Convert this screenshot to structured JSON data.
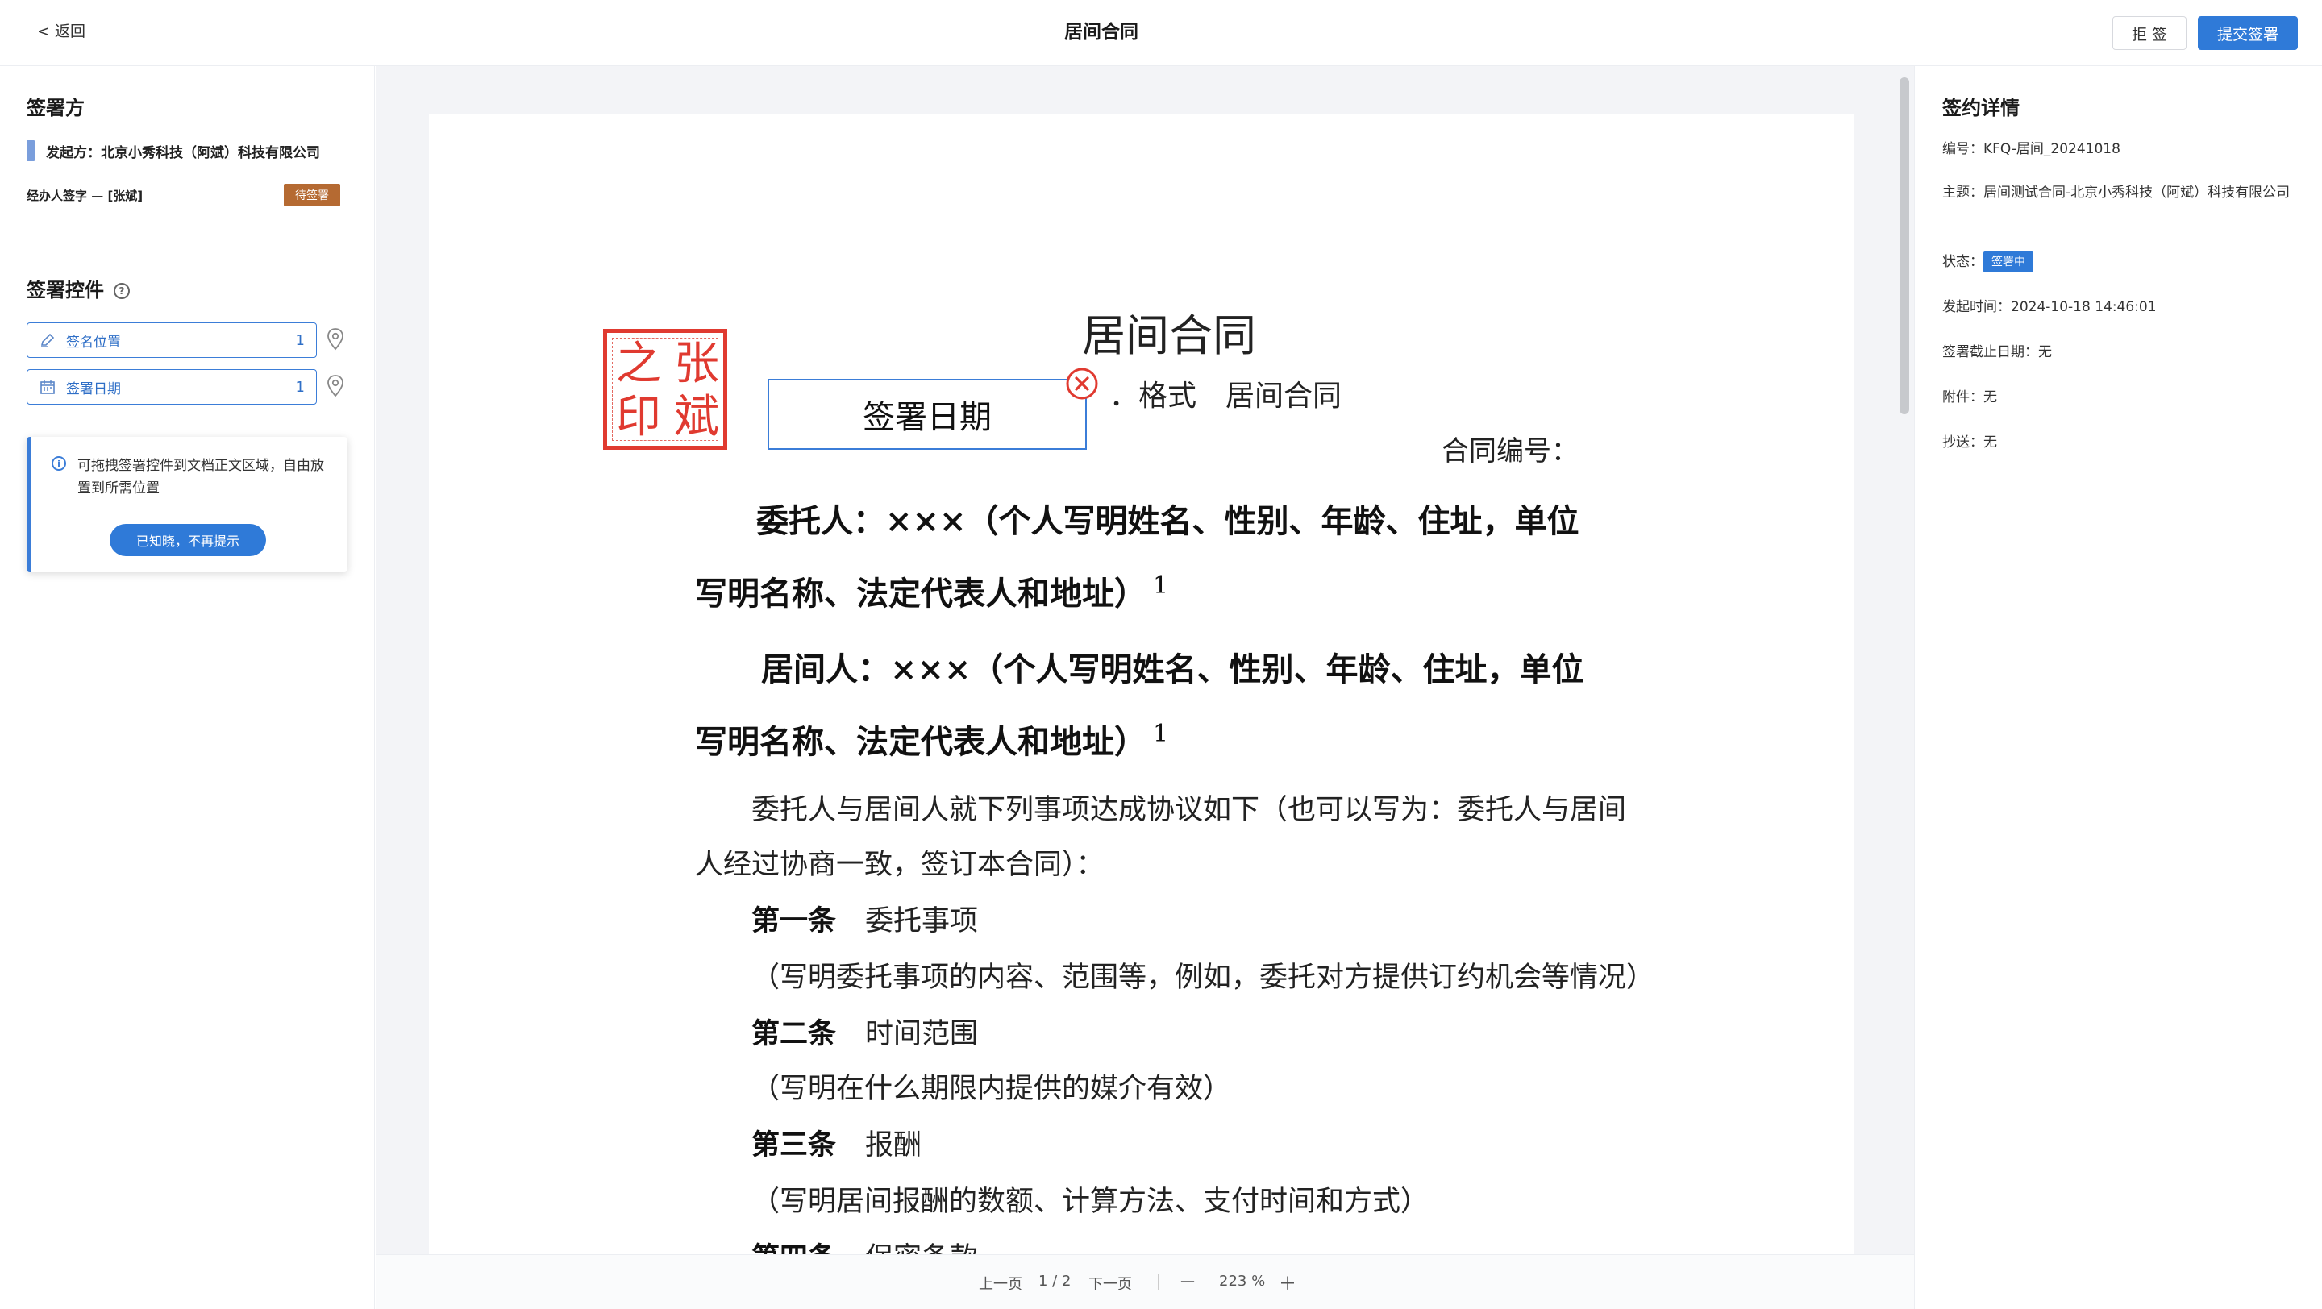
{
  "header": {
    "back_label": "< 返回",
    "title": "居间合同",
    "reject_label": "拒 签",
    "submit_label": "提交签署"
  },
  "left": {
    "signers_title": "签署方",
    "initiator": "发起方：北京小秀科技（阿斌）科技有限公司",
    "handler": "经办人签字 — [张斌]",
    "pending_badge": "待签署",
    "controls_title": "签署控件",
    "controls": [
      {
        "label": "签名位置",
        "count": "1",
        "icon": "pen-icon"
      },
      {
        "label": "签署日期",
        "count": "1",
        "icon": "calendar-icon"
      }
    ],
    "tip_text": "可拖拽签署控件到文档正文区域，自由放置到所需位置",
    "tip_button": "已知晓，不再提示"
  },
  "doc": {
    "title": "居间合同",
    "format_line": "．格式　居间合同",
    "contract_no": "合同编号：",
    "principal_line1": "委托人：×××（个人写明姓名、性别、年龄、住址，单位",
    "principal_line2": "写明名称、法定代表人和地址）",
    "intermediary_line1": "居间人：×××（个人写明姓名、性别、年龄、住址，单位",
    "intermediary_line2": "写明名称、法定代表人和地址）",
    "footnote_mark": "1",
    "intro_line1": "委托人与居间人就下列事项达成协议如下（也可以写为：委托人与居间",
    "intro_line2": "人经过协商一致，签订本合同）：",
    "articles": [
      {
        "num": "第一条",
        "title": "委托事项",
        "detail": "（写明委托事项的内容、范围等，例如，委托对方提供订约机会等情况）"
      },
      {
        "num": "第二条",
        "title": "时间范围",
        "detail": "（写明在什么期限内提供的媒介有效）"
      },
      {
        "num": "第三条",
        "title": "报酬",
        "detail": "（写明居间报酬的数额、计算方法、支付时间和方式）"
      },
      {
        "num": "第四条",
        "title": "保密条款"
      }
    ],
    "seal_chars": [
      "张",
      "斌",
      "之",
      "印"
    ],
    "sign_date_label": "签署日期"
  },
  "pager": {
    "prev": "上一页",
    "page": "1 / 2",
    "next": "下一页",
    "zoom_out": "—",
    "zoom": "223 %",
    "zoom_in": "＋"
  },
  "right": {
    "title": "签约详情",
    "number": "编号：KFQ-居间_20241018",
    "subject": "主题：居间测试合同-北京小秀科技（阿斌）科技有限公司",
    "status_label": "状态：",
    "status_value": "签署中",
    "initiated": "发起时间：2024-10-18 14:46:01",
    "deadline": "签署截止日期：无",
    "attachment": "附件：无",
    "cc": "抄送：无"
  },
  "colors": {
    "accent": "#2f7ad8",
    "seal": "#e03a30",
    "pending": "#b56a32"
  }
}
